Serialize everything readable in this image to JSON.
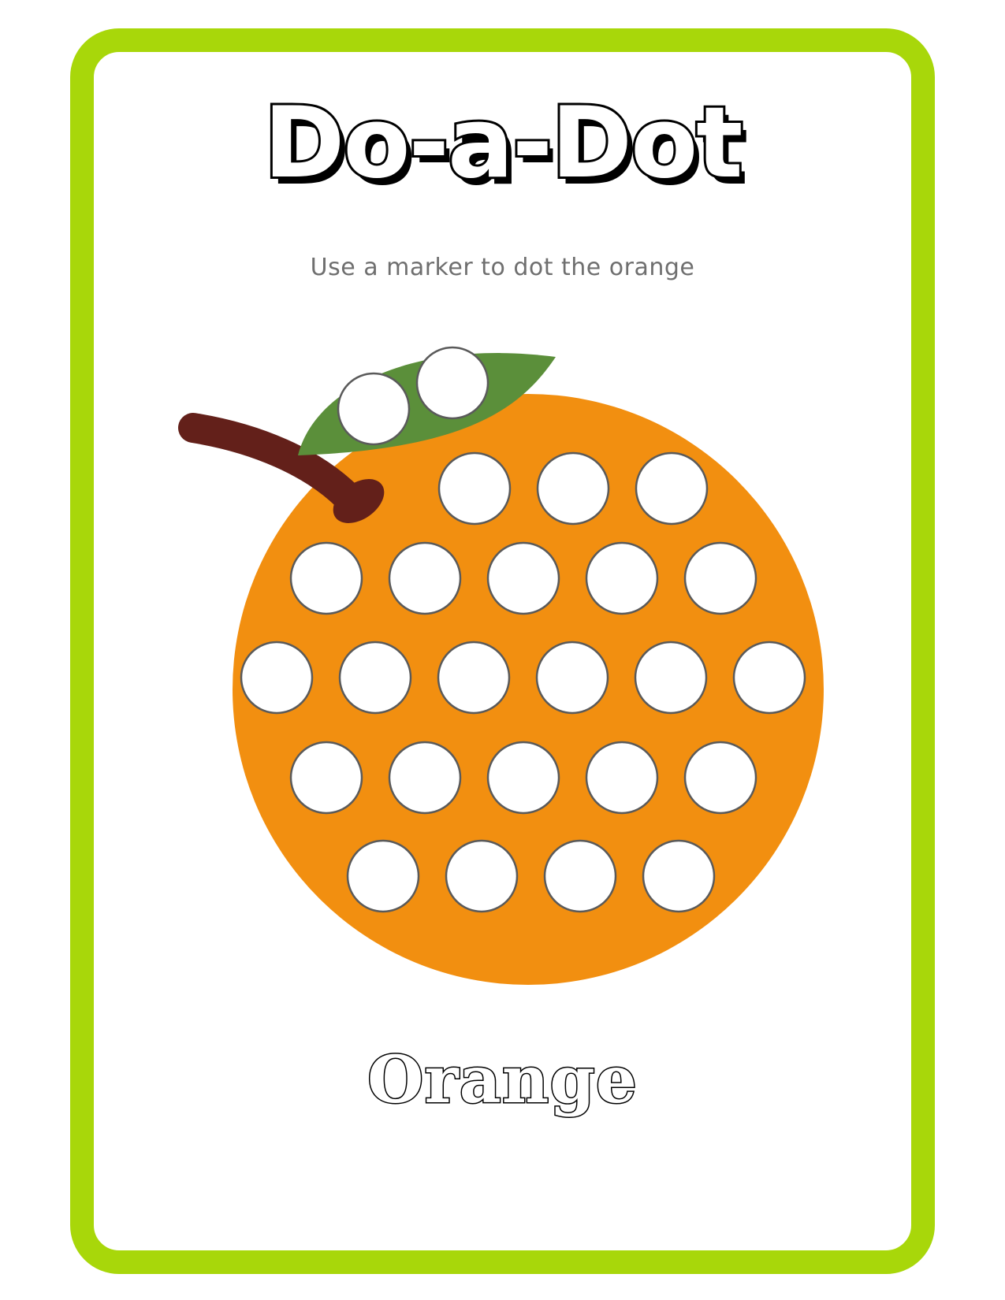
{
  "page": {
    "title": "Do-a-Dot",
    "instruction": "Use a marker to dot the orange",
    "fruit_label": "Orange"
  },
  "colors": {
    "frame": "#a8d70a",
    "orange_fill": "#f28f10",
    "leaf": "#5b8f3a",
    "stem": "#63201a",
    "dot_fill": "#ffffff",
    "dot_outline": "#5a5a5a"
  },
  "dots": {
    "leaf_count": 2,
    "row_counts": [
      3,
      5,
      6,
      5,
      4
    ]
  }
}
